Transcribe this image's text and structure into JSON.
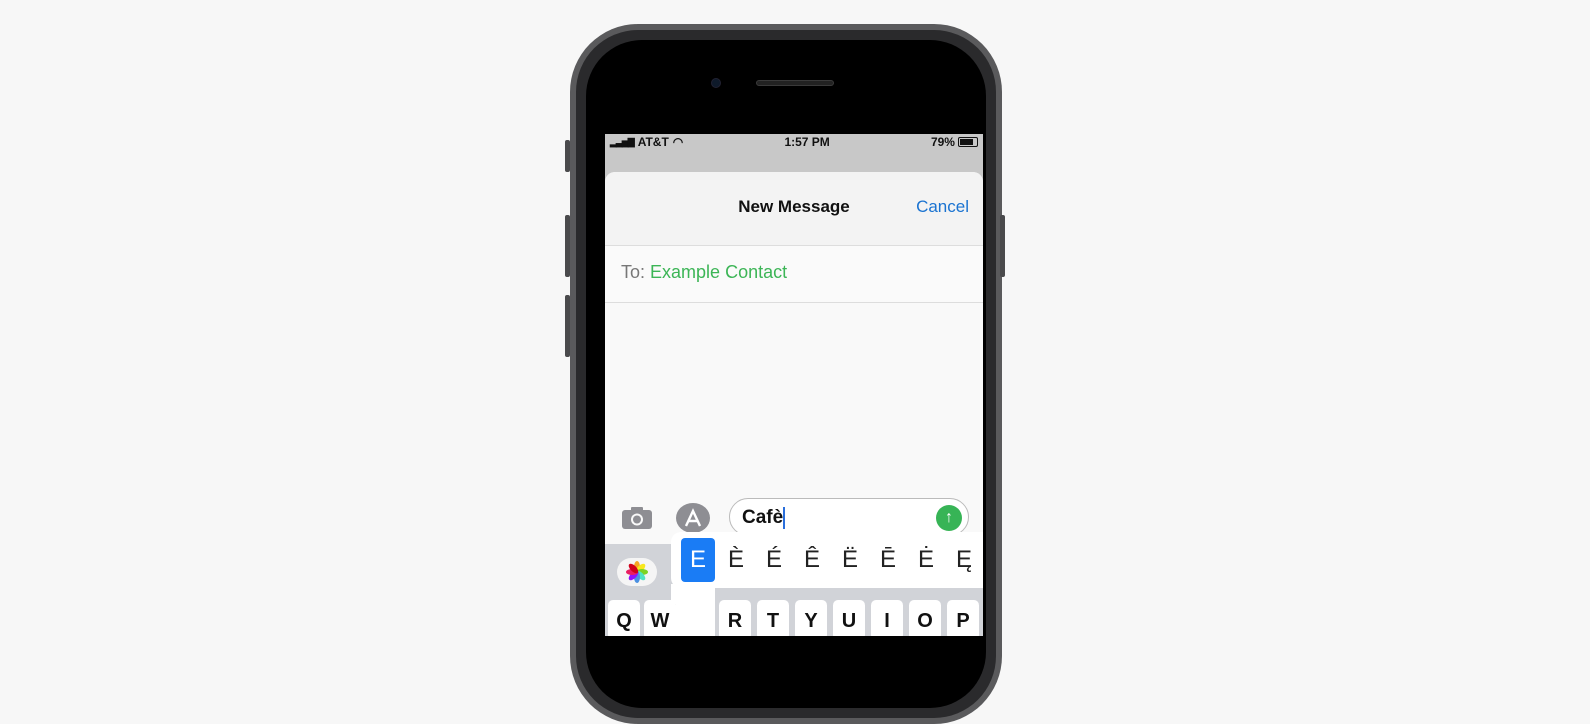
{
  "status_bar": {
    "carrier": "AT&T",
    "time": "1:57 PM",
    "battery": "79%"
  },
  "header": {
    "title": "New Message",
    "cancel_label": "Cancel"
  },
  "to_field": {
    "label": "To:",
    "contact": "Example Contact"
  },
  "message_input": {
    "value": "Cafè"
  },
  "accent_popup": {
    "options": [
      "E",
      "È",
      "É",
      "Ê",
      "Ë",
      "Ē",
      "Ė",
      "Ę"
    ],
    "selected": "E"
  },
  "keyboard": {
    "row1": [
      "Q",
      "W",
      "R",
      "T",
      "Y",
      "U",
      "I",
      "O",
      "P"
    ]
  },
  "colors": {
    "accent_blue": "#1a73d1",
    "contact_green": "#3cb556",
    "send_green": "#37b456",
    "selected_key": "#1a7cf5"
  }
}
